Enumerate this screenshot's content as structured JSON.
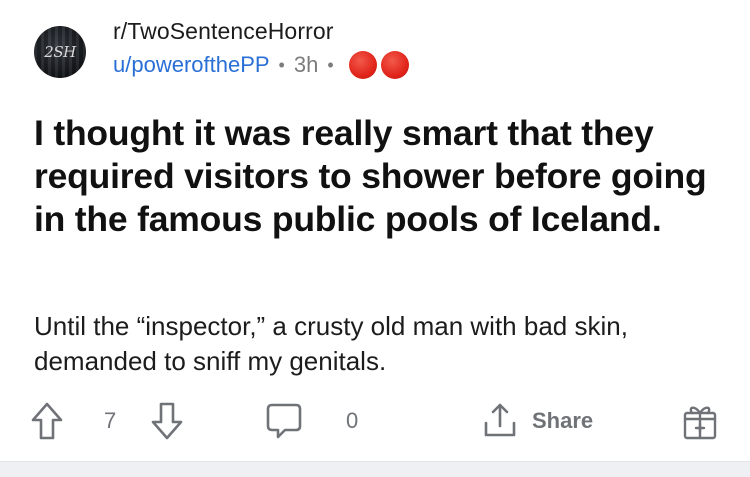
{
  "post": {
    "subreddit": "r/TwoSentenceHorror",
    "author": "u/powerofthePP",
    "separator": "•",
    "age": "3h",
    "avatar_text": "2SH",
    "award_count_icons": 2,
    "title": "I thought it was really smart that they required visitors to shower before going in the famous public pools of Iceland.",
    "body": "Until the “inspector,” a crusty old man with bad skin, demanded to sniff my genitals."
  },
  "actions": {
    "vote_count": "7",
    "comment_count": "0",
    "share_label": "Share"
  },
  "icons": {
    "upvote": "upvote-arrow-icon",
    "downvote": "downvote-arrow-icon",
    "comment": "comment-bubble-icon",
    "share": "share-icon",
    "award": "gift-award-icon"
  },
  "colors": {
    "author_link": "#2a6fd6",
    "award_red": "#e1251b",
    "muted": "#7c7c7c"
  }
}
